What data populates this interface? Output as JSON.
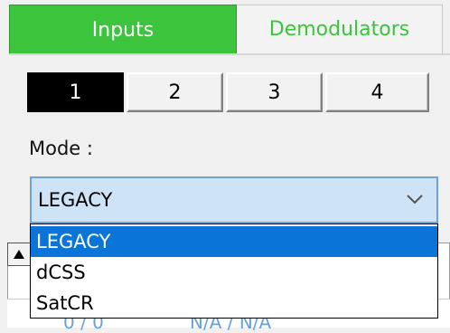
{
  "tabs": [
    {
      "label": "Inputs",
      "active": true
    },
    {
      "label": "Demodulators",
      "active": false
    }
  ],
  "input_tabs": [
    {
      "label": "1",
      "active": true
    },
    {
      "label": "2",
      "active": false
    },
    {
      "label": "3",
      "active": false
    },
    {
      "label": "4",
      "active": false
    }
  ],
  "mode": {
    "label": "Mode :",
    "selected": "LEGACY",
    "options": [
      "LEGACY",
      "dCSS",
      "SatCR"
    ],
    "highlighted_index": 0
  },
  "background_row": {
    "col1": "0 / 0",
    "col2": "N/A / N/A"
  },
  "colors": {
    "active_tab": "#3cc43c",
    "inactive_tab_text": "#3cc43c",
    "selection": "#0a74d8",
    "combo_fill": "#cfe3f7"
  },
  "icons": [
    "chevron-down-icon",
    "up-arrow-icon"
  ]
}
